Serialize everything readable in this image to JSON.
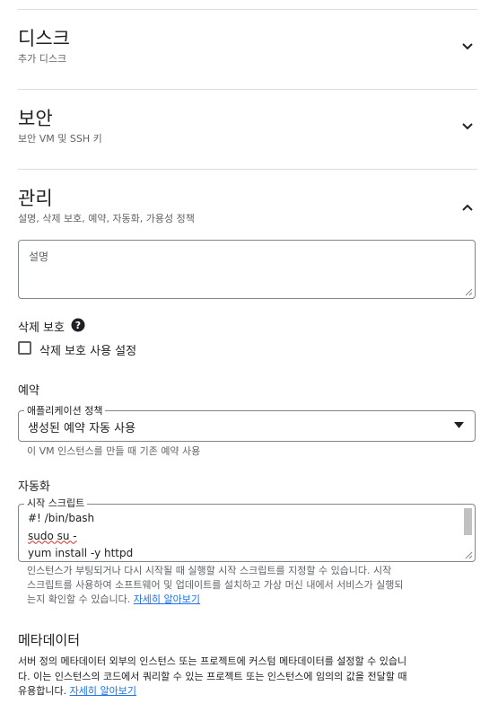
{
  "disk": {
    "title": "디스크",
    "subtitle": "추가 디스크",
    "icon": "chevron-down-icon"
  },
  "security": {
    "title": "보안",
    "subtitle": "보안 VM 및 SSH 키",
    "icon": "chevron-down-icon"
  },
  "management": {
    "title": "관리",
    "subtitle": "설명, 삭제 보호, 예약, 자동화, 가용성 정책",
    "icon": "chevron-up-icon",
    "description": {
      "placeholder": "설명",
      "value": ""
    },
    "deletion_protection": {
      "label": "삭제 보호",
      "help_icon": "help-icon",
      "checkbox_label": "삭제 보호 사용 설정",
      "checked": false
    },
    "reservation": {
      "heading": "예약",
      "select_label": "애플리케이션 정책",
      "select_value": "생성된 예약 자동 사용",
      "helper": "이 VM 인스턴스를 만들 때 기존 예약 사용"
    },
    "automation": {
      "heading": "자동화",
      "textarea_label": "시작 스크립트",
      "script_lines": [
        "#! /bin/bash",
        "sudo su -",
        "yum install -y httpd"
      ],
      "helper_line1": "인스턴스가 부팅되거나 다시 시작될 때 실행할 시작 스크립트를 지정할 수 있습니다. 시작",
      "helper_line2": "스크립트를 사용하여 소프트웨어 및 업데이트를 설치하고 가상 머신 내에서 서비스가 실행되",
      "helper_line3": "는지 확인할 수 있습니다.",
      "learn_more": "자세히 알아보기"
    },
    "metadata": {
      "heading": "메타데이터",
      "line1": "서버 정의 메타데이터 외부의 인스턴스 또는 프로젝트에 커스텀 메타데이터를 설정할 수 있습니",
      "line2": "다. 이는 인스턴스의 코드에서 쿼리할 수 있는 프로젝트 또는 인스턴스에 임의의 값을 전달할 때",
      "line3": "유용합니다.",
      "learn_more": "자세히 알아보기"
    }
  }
}
